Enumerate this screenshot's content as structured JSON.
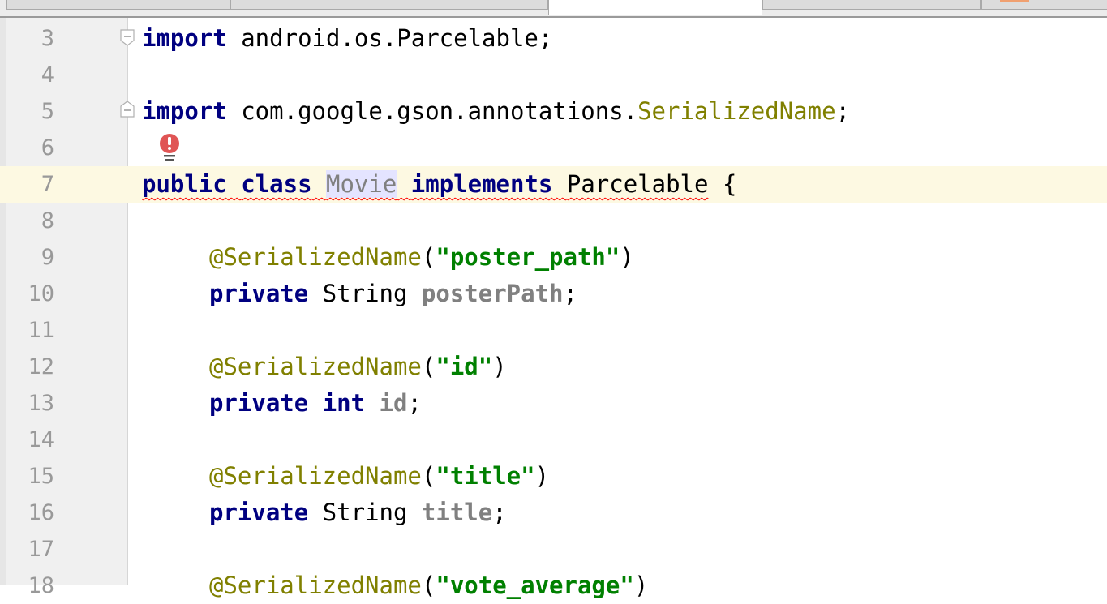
{
  "editor": {
    "lines": [
      {
        "num": "3"
      },
      {
        "num": "4"
      },
      {
        "num": "5"
      },
      {
        "num": "6"
      },
      {
        "num": "7"
      },
      {
        "num": "8"
      },
      {
        "num": "9"
      },
      {
        "num": "10"
      },
      {
        "num": "11"
      },
      {
        "num": "12"
      },
      {
        "num": "13"
      },
      {
        "num": "14"
      },
      {
        "num": "15"
      },
      {
        "num": "16"
      },
      {
        "num": "17"
      },
      {
        "num": "18"
      }
    ],
    "tokens": {
      "import": "import",
      "android_parcelable": " android.os.Parcelable;",
      "gson_pkg": " com.google.gson.annotations.",
      "serialized_name": "SerializedName",
      "semicolon": ";",
      "public": "public",
      "class": "class",
      "movie": "Movie",
      "implements": "implements",
      "parcelable": "Parcelable",
      "open_brace": " {",
      "annotation": "@SerializedName",
      "open_paren": "(",
      "close_paren": ")",
      "poster_path_str": "\"poster_path\"",
      "private": "private",
      "string_type": "String",
      "poster_path_field": "posterPath",
      "id_str": "\"id\"",
      "int_type": "int",
      "id_field": "id",
      "title_str": "\"title\"",
      "title_field": "title",
      "vote_average_str": "\"vote_average\""
    }
  },
  "colors": {
    "keyword": "#000080",
    "annotation": "#808000",
    "string": "#008000",
    "field": "#808080",
    "current_line": "#fdf9e2",
    "error": "#ff0000"
  },
  "icons": {
    "error_bulb": "error-bulb-icon",
    "fold_marker": "fold-marker-icon"
  }
}
